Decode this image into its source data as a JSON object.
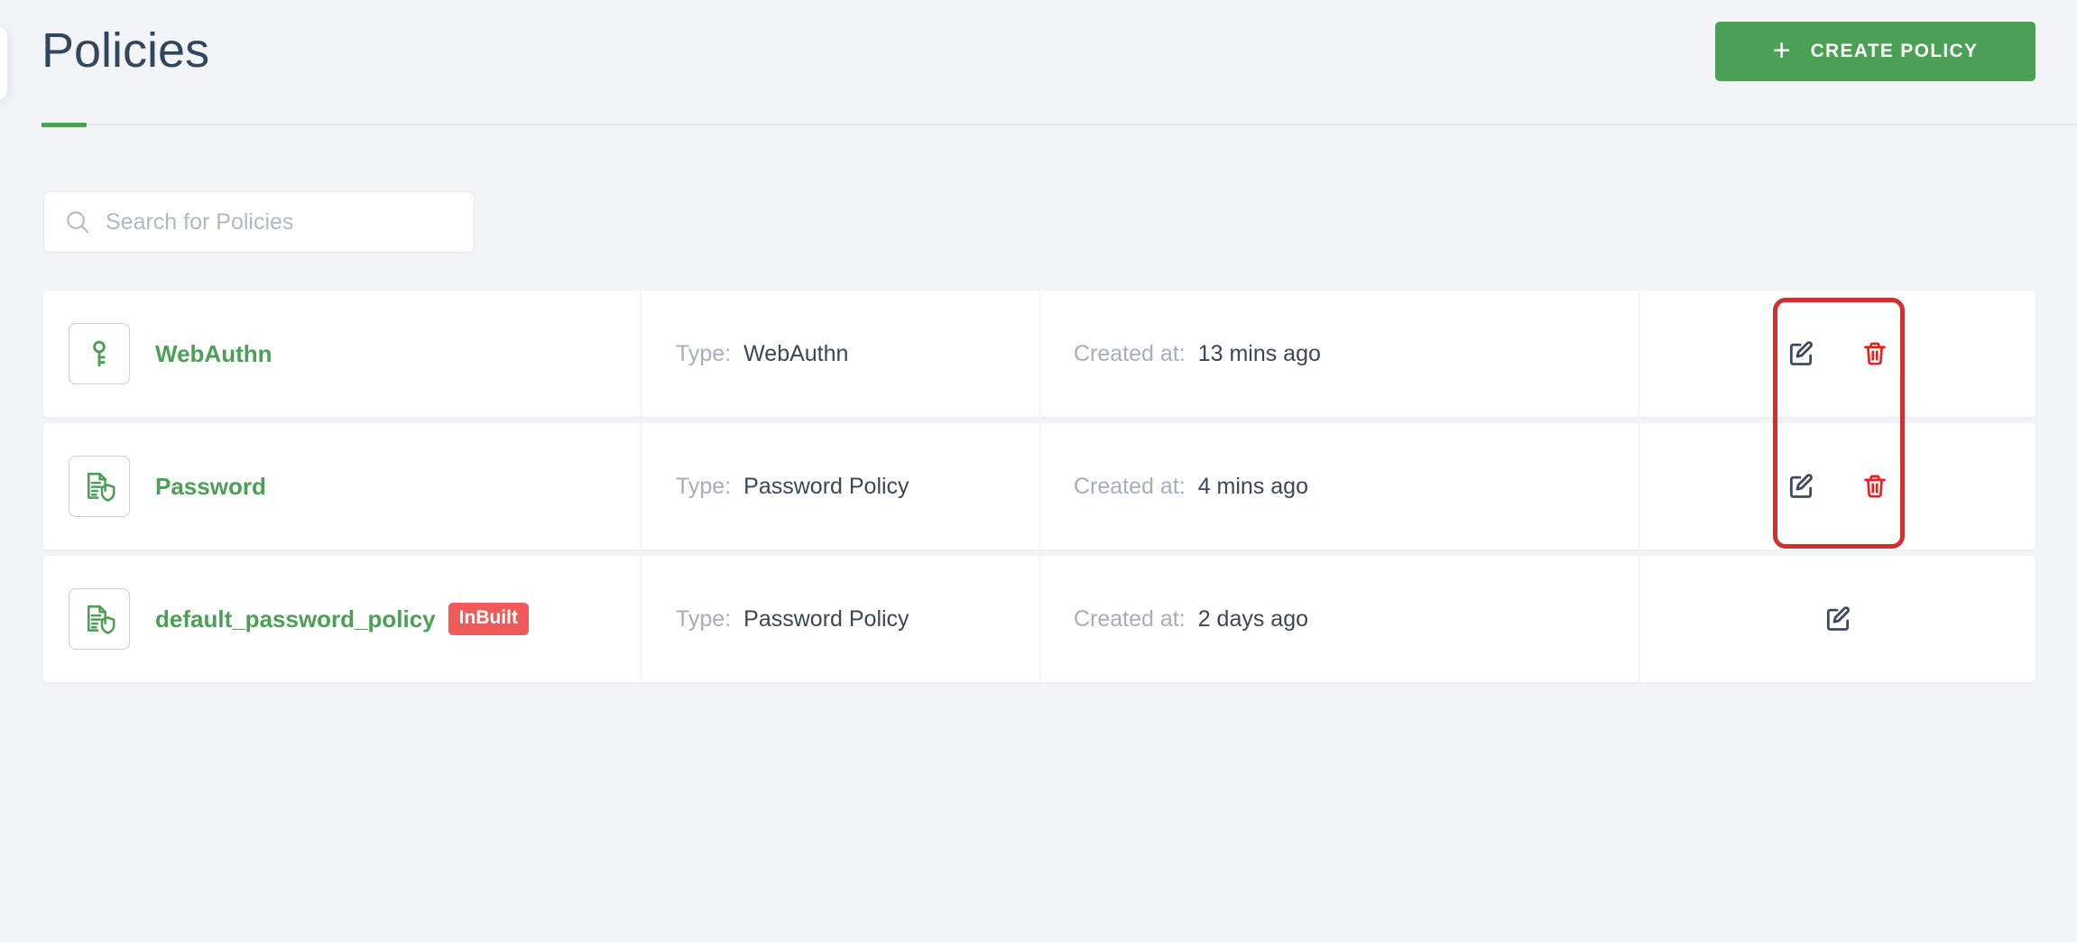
{
  "header": {
    "title": "Policies",
    "create_button": {
      "label": "Create Policy",
      "plus_icon": "plus-icon"
    }
  },
  "search": {
    "placeholder": "Search for Policies",
    "value": "",
    "icon": "search-icon"
  },
  "table": {
    "type_label": "Type:",
    "created_label": "Created at:",
    "rows": [
      {
        "icon": "key-icon",
        "name": "WebAuthn",
        "badge": null,
        "type": "WebAuthn",
        "created_at": "13 mins ago",
        "actions": [
          "edit-icon",
          "delete-icon"
        ]
      },
      {
        "icon": "document-shield-icon",
        "name": "Password",
        "badge": null,
        "type": "Password Policy",
        "created_at": "4 mins ago",
        "actions": [
          "edit-icon",
          "delete-icon"
        ]
      },
      {
        "icon": "document-shield-icon",
        "name": "default_password_policy",
        "badge": "InBuilt",
        "type": "Password Policy",
        "created_at": "2 days ago",
        "actions": [
          "edit-icon"
        ]
      }
    ]
  },
  "annotation": {
    "shape": "rounded-rectangle-outline",
    "color": "#d32f2f",
    "targets": "row-actions-edit-delete"
  },
  "colors": {
    "brand_green": "#4ba055",
    "title": "#33475b",
    "page_background": "#f2f4f8",
    "badge_red": "#ef5b5b",
    "delete_red": "#f01c1c",
    "edit_dark": "#3e4a5c",
    "label_grey": "#a7adbb"
  }
}
